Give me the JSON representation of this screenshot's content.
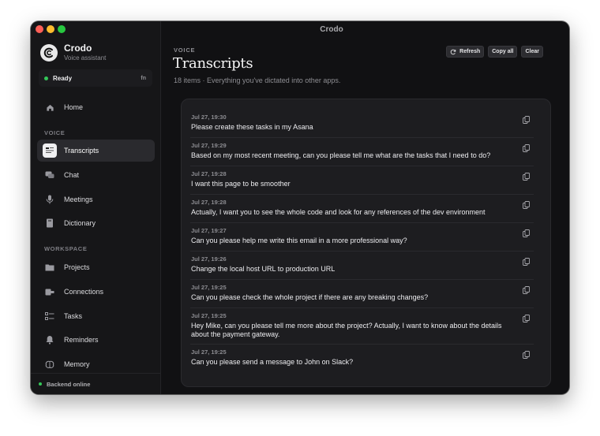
{
  "window": {
    "title": "Crodo"
  },
  "brand": {
    "name": "Crodo",
    "subtitle": "Voice assistant"
  },
  "status": {
    "label": "Ready",
    "shortcut": "fn",
    "color": "#34c759"
  },
  "nav": {
    "home": "Home",
    "voice_section": "VOICE",
    "workspace_section": "WORKSPACE",
    "items": [
      {
        "label": "Transcripts",
        "icon": "transcripts-icon",
        "active": true
      },
      {
        "label": "Chat",
        "icon": "chat-icon"
      },
      {
        "label": "Meetings",
        "icon": "microphone-icon"
      },
      {
        "label": "Dictionary",
        "icon": "book-icon"
      },
      {
        "label": "Projects",
        "icon": "folder-icon"
      },
      {
        "label": "Connections",
        "icon": "plug-icon"
      },
      {
        "label": "Tasks",
        "icon": "checklist-icon"
      },
      {
        "label": "Reminders",
        "icon": "bell-icon"
      },
      {
        "label": "Memory",
        "icon": "brain-icon"
      }
    ]
  },
  "footer": {
    "label": "Backend online"
  },
  "page": {
    "eyebrow": "VOICE",
    "title": "Transcripts",
    "subtitle": "18 items · Everything you've dictated into other apps."
  },
  "toolbar": {
    "refresh": "Refresh",
    "copy_all": "Copy all",
    "clear": "Clear"
  },
  "transcripts": [
    {
      "time": "Jul 27, 19:30",
      "text": "Please create these tasks in my Asana"
    },
    {
      "time": "Jul 27, 19:29",
      "text": "Based on my most recent meeting, can you please tell me what are the tasks that I need to do?"
    },
    {
      "time": "Jul 27, 19:28",
      "text": "I want this page to be smoother"
    },
    {
      "time": "Jul 27, 19:28",
      "text": "Actually, I want you to see the whole code and look for any references of the dev environment"
    },
    {
      "time": "Jul 27, 19:27",
      "text": "Can you please help me write this email in a more professional way?"
    },
    {
      "time": "Jul 27, 19:26",
      "text": "Change the local host URL to production URL"
    },
    {
      "time": "Jul 27, 19:25",
      "text": "Can you please check the whole project if there are any breaking changes?"
    },
    {
      "time": "Jul 27, 19:25",
      "text": "Hey Mike, can you please tell me more about the project? Actually, I want to know about the details about the payment gateway."
    },
    {
      "time": "Jul 27, 19:25",
      "text": "Can you please send a message to John on Slack?"
    }
  ]
}
